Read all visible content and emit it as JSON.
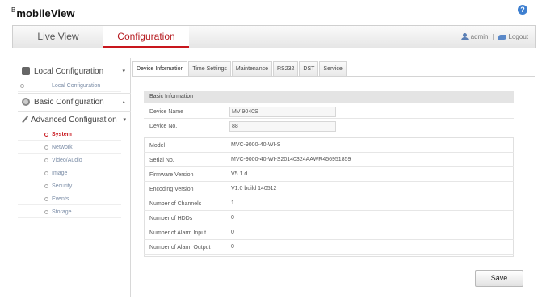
{
  "app": {
    "logo_mark": "B",
    "logo_text": "mobileView",
    "help_icon": "help-icon"
  },
  "nav": {
    "tabs": [
      {
        "label": "Live View"
      },
      {
        "label": "Configuration",
        "active": true
      }
    ],
    "user": "admin",
    "separator": "|",
    "logout": "Logout"
  },
  "sidebar": {
    "local_config": "Local Configuration",
    "local_config_sub": "Local Configuration",
    "basic_config": "Basic Configuration",
    "advanced_config": "Advanced Configuration",
    "advanced_items": [
      "System",
      "Network",
      "Video/Audio",
      "Image",
      "Security",
      "Events",
      "Storage"
    ],
    "active_item": "System"
  },
  "tabs": [
    "Device Information",
    "Time Settings",
    "Maintenance",
    "RS232",
    "DST",
    "Service"
  ],
  "active_tab": "Device Information",
  "basic_info": {
    "title": "Basic Information",
    "device_name_label": "Device Name",
    "device_name_value": "MV 9040S",
    "device_no_label": "Device No.",
    "device_no_value": "88"
  },
  "details": [
    {
      "label": "Model",
      "value": "MVC-9000-40-WI-S"
    },
    {
      "label": "Serial No.",
      "value": "MVC-9000-40-WI-S20140324AAWR456951859"
    },
    {
      "label": "Firmware Version",
      "value": "V5.1.d"
    },
    {
      "label": "Encoding Version",
      "value": "V1.0 build 140512"
    },
    {
      "label": "Number of Channels",
      "value": "1"
    },
    {
      "label": "Number of HDDs",
      "value": "0"
    },
    {
      "label": "Number of Alarm Input",
      "value": "0"
    },
    {
      "label": "Number of Alarm Output",
      "value": "0"
    }
  ],
  "buttons": {
    "save": "Save"
  },
  "colors": {
    "accent": "#c8161d",
    "link": "#7a8ca6",
    "help": "#3d7fd0"
  }
}
